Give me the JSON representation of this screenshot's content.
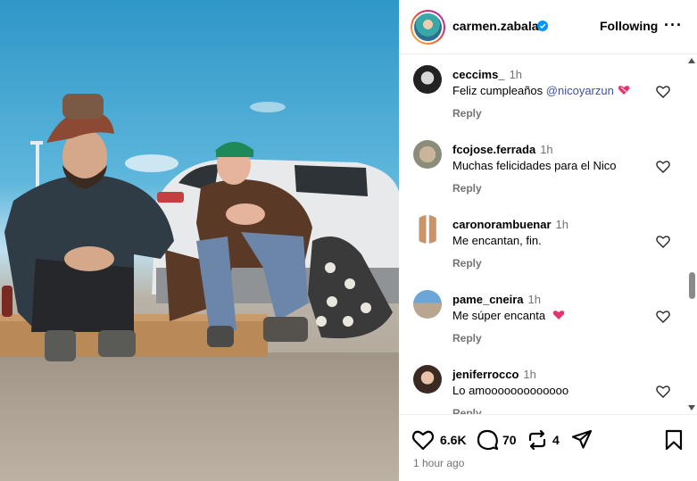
{
  "post": {
    "image_alt": "Photo of two people sitting on the ground in front of a car",
    "time_ago": "1 hour ago"
  },
  "header": {
    "username": "carmen.zabala",
    "verified": true,
    "follow_label": "Following",
    "more_label": "···"
  },
  "comments": [
    {
      "user": "ceccims_",
      "time": "1h",
      "text": "Feliz cumpleaños ",
      "mention": "@nicoyarzun",
      "emoji": "heart-with-ribbon",
      "reply": "Reply"
    },
    {
      "user": "fcojose.ferrada",
      "time": "1h",
      "text": "Muchas felicidades para el Nico",
      "reply": "Reply"
    },
    {
      "user": "caronorambuenar",
      "time": "1h",
      "text": "Me encantan, fin.",
      "reply": "Reply"
    },
    {
      "user": "pame_cneira",
      "time": "1h",
      "text": "Me súper encanta ",
      "emoji": "pink-heart",
      "reply": "Reply"
    },
    {
      "user": "jeniferrocco",
      "time": "1h",
      "text": "Lo amooooooooooooo",
      "reply": "Reply"
    }
  ],
  "actions": {
    "likes": "6.6K",
    "comments": "70",
    "reposts": "4"
  },
  "colors": {
    "mention": "#4150a7",
    "secondary_text": "#737373",
    "verified": "#0095f6",
    "emoji_heart": "#e8336b"
  }
}
